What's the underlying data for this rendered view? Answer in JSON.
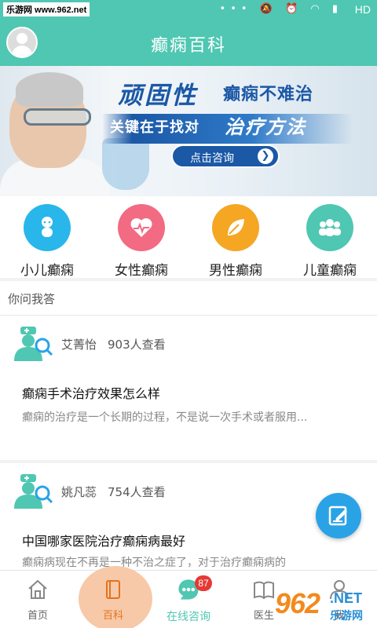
{
  "status_bar": {
    "source_label": "乐游网 www.962.net",
    "network": "HD",
    "icons": [
      "more-icon",
      "mute-icon",
      "alarm-icon",
      "wifi-icon",
      "signal-icon"
    ]
  },
  "header": {
    "title": "癫痫百科"
  },
  "banner": {
    "headline_big": "顽固性",
    "headline_rest": "癫痫不难治",
    "subline": "关键在于找对",
    "subline_script": "治疗方法",
    "button_label": "点击咨询",
    "colors": {
      "brand_blue": "#1b58a6"
    }
  },
  "categories": [
    {
      "label": "小儿癫痫",
      "icon": "baby-icon",
      "color": "#29b6ea"
    },
    {
      "label": "女性癫痫",
      "icon": "heart-pulse-icon",
      "color": "#f26b82"
    },
    {
      "label": "男性癫痫",
      "icon": "leaf-icon",
      "color": "#f5a623"
    },
    {
      "label": "儿童癫痫",
      "icon": "group-icon",
      "color": "#4fc7b2"
    }
  ],
  "qa": {
    "section_title": "你问我答",
    "items": [
      {
        "author": "艾菁怡",
        "views": "903人查看",
        "question": "癫痫手术治疗效果怎么样",
        "answer": "癫痫的治疗是一个长期的过程，不是说一次手术或者服用..."
      },
      {
        "author": "姚凡蕊",
        "views": "754人查看",
        "question": "中国哪家医院治疗癫痫病最好",
        "answer": "癫痫病现在不再是一种不治之症了，对于治疗癫痫病的"
      }
    ]
  },
  "tabbar": {
    "tabs": [
      {
        "label": "首页",
        "icon": "home-icon"
      },
      {
        "label": "百科",
        "icon": "book-icon"
      },
      {
        "label": "在线咨询",
        "icon": "chat-icon",
        "badge": "87"
      },
      {
        "label": "医生",
        "icon": "open-book-icon"
      },
      {
        "label": "我",
        "icon": "person-icon"
      }
    ]
  },
  "watermark": {
    "number": "962",
    "net": ".NET",
    "site": "乐游网"
  },
  "colors": {
    "primary": "#4fc7b2",
    "fab": "#2aa3e6",
    "active_tab": "#e3731e",
    "badge": "#e53935"
  }
}
